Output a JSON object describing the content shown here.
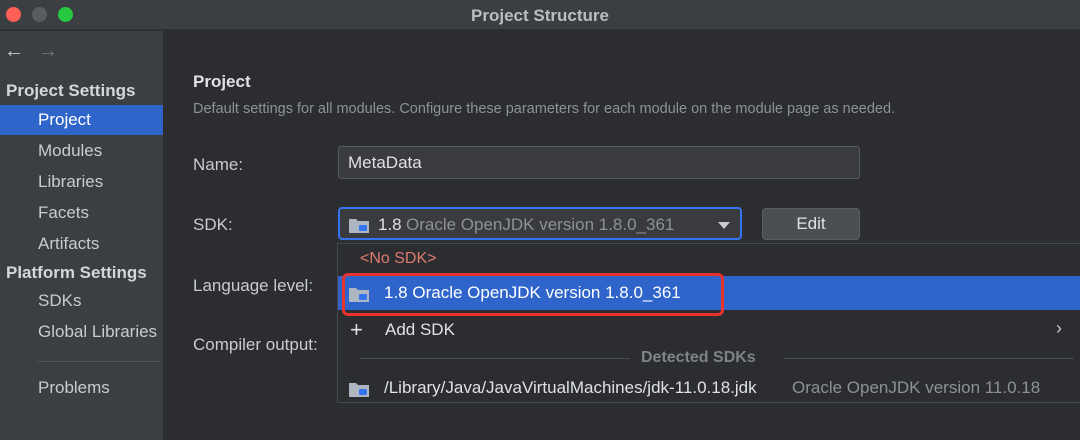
{
  "window": {
    "title": "Project Structure"
  },
  "nav": {
    "back": "←",
    "forward": "→"
  },
  "sidebar": {
    "project_settings_header": "Project Settings",
    "project_items": [
      "Project",
      "Modules",
      "Libraries",
      "Facets",
      "Artifacts"
    ],
    "platform_settings_header": "Platform Settings",
    "platform_items": [
      "SDKs",
      "Global Libraries"
    ],
    "problems": "Problems",
    "selected": "Project"
  },
  "main": {
    "title": "Project",
    "description": "Default settings for all modules. Configure these parameters for each module on the module page as needed.",
    "name_label": "Name:",
    "name_value": "MetaData",
    "sdk_label": "SDK:",
    "sdk_version": "1.8",
    "sdk_name": "Oracle OpenJDK version 1.8.0_361",
    "edit_button": "Edit",
    "language_level_label": "Language level:",
    "compiler_output_label": "Compiler output:"
  },
  "dropdown": {
    "no_sdk": "<No SDK>",
    "selected_item": "1.8 Oracle OpenJDK version 1.8.0_361",
    "add_sdk": "Add SDK",
    "detected_header": "Detected SDKs",
    "detected": [
      {
        "path": "/Library/Java/JavaVirtualMachines/jdk-11.0.18.jdk",
        "version": "Oracle OpenJDK version 11.0.18"
      }
    ]
  },
  "colors": {
    "selection": "#2f65ca",
    "highlight_box": "#e8322f",
    "focus_border": "#3574f0",
    "error_text": "#e07a6f"
  }
}
